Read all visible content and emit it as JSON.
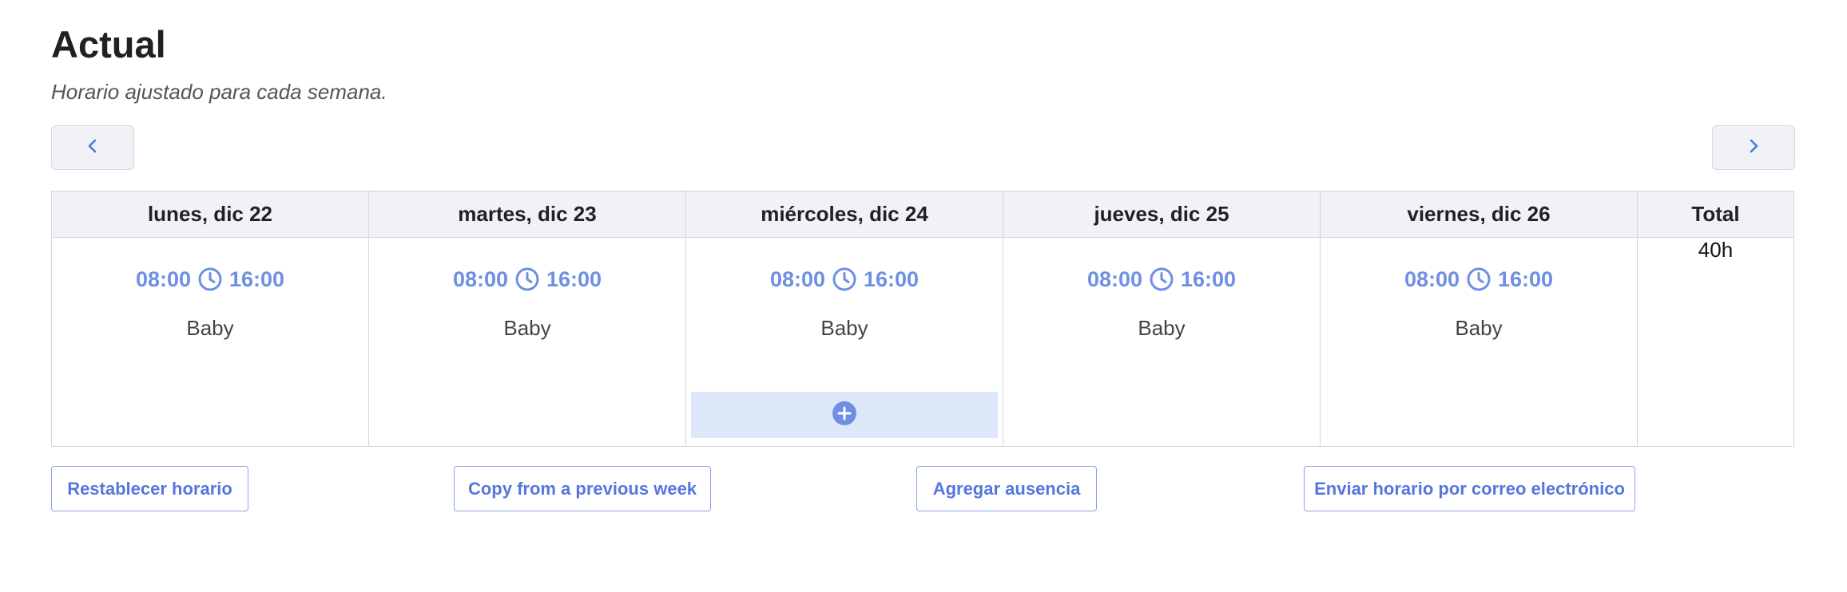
{
  "page": {
    "title": "Actual",
    "subtitle": "Horario ajustado para cada semana."
  },
  "nav": {
    "prev_icon": "chevron-left-icon",
    "next_icon": "chevron-right-icon"
  },
  "colors": {
    "accent": "#6f8fe4",
    "header_bg": "#f1f2f7",
    "add_slot_bg": "#dde9fa",
    "add_icon": "#6f8fe4"
  },
  "schedule": {
    "days": [
      {
        "header": "lunes, dic 22",
        "start": "08:00",
        "end": "16:00",
        "person": "Baby"
      },
      {
        "header": "martes, dic 23",
        "start": "08:00",
        "end": "16:00",
        "person": "Baby"
      },
      {
        "header": "miércoles, dic 24",
        "start": "08:00",
        "end": "16:00",
        "person": "Baby"
      },
      {
        "header": "jueves, dic 25",
        "start": "08:00",
        "end": "16:00",
        "person": "Baby"
      },
      {
        "header": "viernes, dic 26",
        "start": "08:00",
        "end": "16:00",
        "person": "Baby"
      }
    ],
    "total_header": "Total",
    "total_value": "40h"
  },
  "actions": {
    "reset": "Restablecer horario",
    "copy": "Copy from a previous week",
    "absence": "Agregar ausencia",
    "email": "Enviar horario por correo electrónico"
  }
}
